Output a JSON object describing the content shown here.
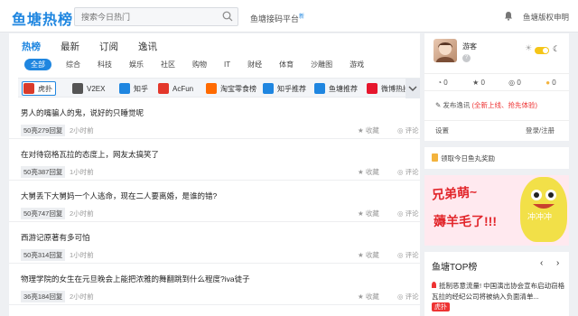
{
  "header": {
    "logo": "鱼塘热榜",
    "search_placeholder": "搜索今日热门",
    "platform": "鱼塘接码平台",
    "platform_badge": "新",
    "copyright": "鱼塘版权申明"
  },
  "tabs": [
    "热榜",
    "最新",
    "订阅",
    "逸讯"
  ],
  "filters": [
    "全部",
    "综合",
    "科技",
    "娱乐",
    "社区",
    "购物",
    "IT",
    "财经",
    "体育",
    "沙雕图",
    "游戏"
  ],
  "sources": [
    {
      "name": "虎扑",
      "color": "#d93b2b"
    },
    {
      "name": "V2EX",
      "color": "#555555"
    },
    {
      "name": "知乎",
      "color": "#1f86e0"
    },
    {
      "name": "AcFun",
      "color": "#e3372b"
    },
    {
      "name": "淘宝零食榜",
      "color": "#ff6a00"
    },
    {
      "name": "知乎推荐",
      "color": "#1f86e0"
    },
    {
      "name": "鱼塘推荐",
      "color": "#1f86e0"
    },
    {
      "name": "微博热搜",
      "color": "#e6162d"
    }
  ],
  "items": [
    {
      "title": "男人的嘴骗人的鬼，说好的只睡觉呢",
      "heat": "50亮279回复",
      "time": "2小时前",
      "fav": "收藏",
      "comment": "评论"
    },
    {
      "title": "在对待窃格瓦拉的态度上，网友太搞笑了",
      "heat": "50亮387回复",
      "time": "1小时前",
      "fav": "收藏",
      "comment": "评论"
    },
    {
      "title": "大舅丢下大舅妈一个人逃命，现在二人要离婚，是谁的错?",
      "heat": "50亮747回复",
      "time": "2小时前",
      "fav": "收藏",
      "comment": "评论"
    },
    {
      "title": "西游记原著有多可怕",
      "heat": "50亮314回复",
      "time": "1小时前",
      "fav": "收藏",
      "comment": "评论"
    },
    {
      "title": "物理学院的女生在元旦晚会上能把浓雅的舞翻跳到什么程度?iva徒子",
      "heat": "36亮184回复",
      "time": "2小时前",
      "fav": "收藏",
      "comment": "评论"
    }
  ],
  "user": {
    "name": "游客",
    "help": "?",
    "stats": [
      "0",
      "0",
      "0",
      "0"
    ],
    "post": "发布逸讯",
    "post_hint": "(全新上线、抢先体验)",
    "settings": "设置",
    "login": "登录/注册"
  },
  "gift": "领取今日鱼丸奖励",
  "banner": {
    "line1": "兄弟萌~",
    "line2": "薅羊毛了!!!",
    "tag": "冲冲冲"
  },
  "top": {
    "title": "鱼塘TOP榜",
    "news": "抵制恶意流量! 中国演出协会宣布启动窃格瓦拉的经纪公司将被纳入负面清单...",
    "tag": "虎扑"
  }
}
